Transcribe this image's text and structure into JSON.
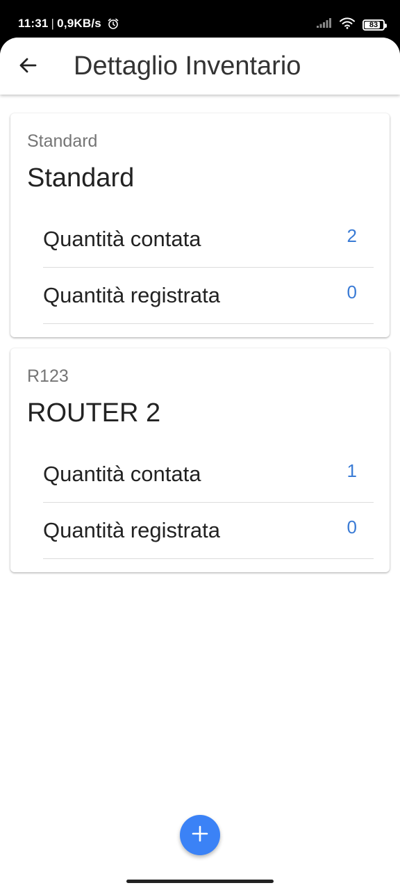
{
  "status_bar": {
    "time": "11:31",
    "separator": "|",
    "net_speed": "0,9KB/s",
    "alarm_icon": "alarm-clock-icon",
    "signal_icon": "cell-signal-icon",
    "wifi_icon": "wifi-icon",
    "battery_level": "83",
    "battery_fraction": 0.83
  },
  "app_bar": {
    "back_icon": "arrow-left-icon",
    "title": "Dettaglio Inventario"
  },
  "items": [
    {
      "code": "Standard",
      "name": "Standard",
      "rows": [
        {
          "label": "Quantità contata",
          "value": "2"
        },
        {
          "label": "Quantità registrata",
          "value": "0"
        }
      ]
    },
    {
      "code": "R123",
      "name": "ROUTER 2",
      "rows": [
        {
          "label": "Quantità contata",
          "value": "1"
        },
        {
          "label": "Quantità registrata",
          "value": "0"
        }
      ]
    }
  ],
  "fab": {
    "icon": "plus-icon"
  },
  "colors": {
    "accent": "#3b82f6",
    "value_text": "#3a7bd5",
    "title_text": "#333333"
  }
}
